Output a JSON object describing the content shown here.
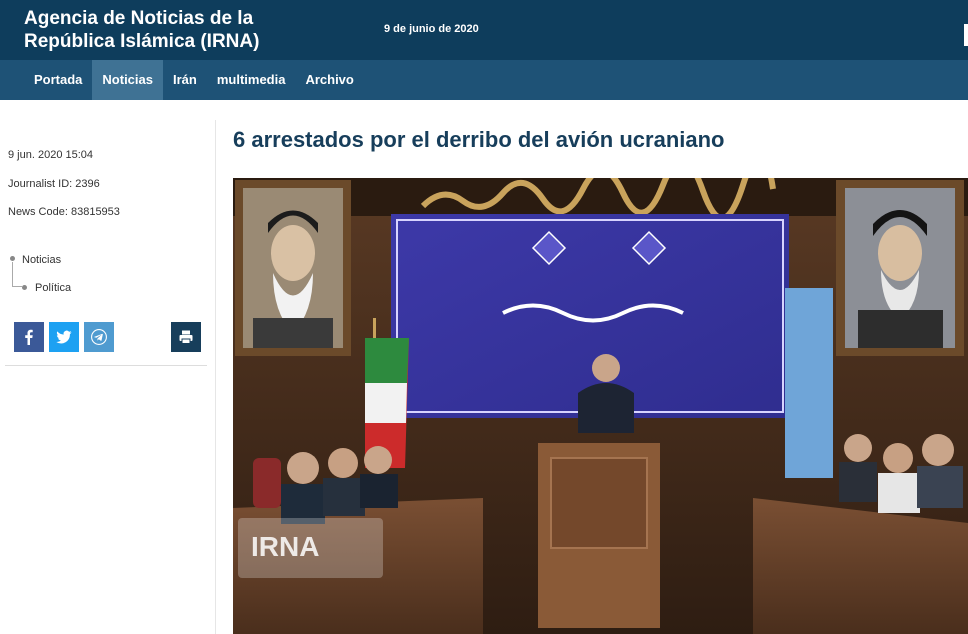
{
  "header": {
    "site_title_line1": "Agencia de Noticias de la",
    "site_title_line2": "República Islámica (IRNA)",
    "date": "9 de junio de 2020"
  },
  "nav": {
    "items": [
      {
        "label": "Portada",
        "active": false
      },
      {
        "label": "Noticias",
        "active": true
      },
      {
        "label": "Irán",
        "active": false
      },
      {
        "label": "multimedia",
        "active": false
      },
      {
        "label": "Archivo",
        "active": false
      }
    ]
  },
  "article": {
    "published": "9 jun. 2020 15:04",
    "journalist_id": "Journalist ID: 2396",
    "news_code": "News Code: 83815953",
    "breadcrumbs": [
      "Noticias",
      "Política"
    ],
    "headline": "6 arrestados por el derribo del avión ucraniano"
  },
  "share": {
    "buttons": [
      {
        "icon": "facebook-icon",
        "color": "#3b5998"
      },
      {
        "icon": "twitter-icon",
        "color": "#1da1f2"
      },
      {
        "icon": "telegram-icon",
        "color": "#4f9bd0"
      },
      {
        "icon": "print-icon",
        "color": "#173e5b"
      }
    ]
  },
  "photo": {
    "watermark": "IRNA"
  },
  "colors": {
    "header_bg": "#0e3d5c",
    "nav_bg": "#1e5276",
    "nav_active_bg": "#3f7294",
    "headline": "#173e5b"
  }
}
